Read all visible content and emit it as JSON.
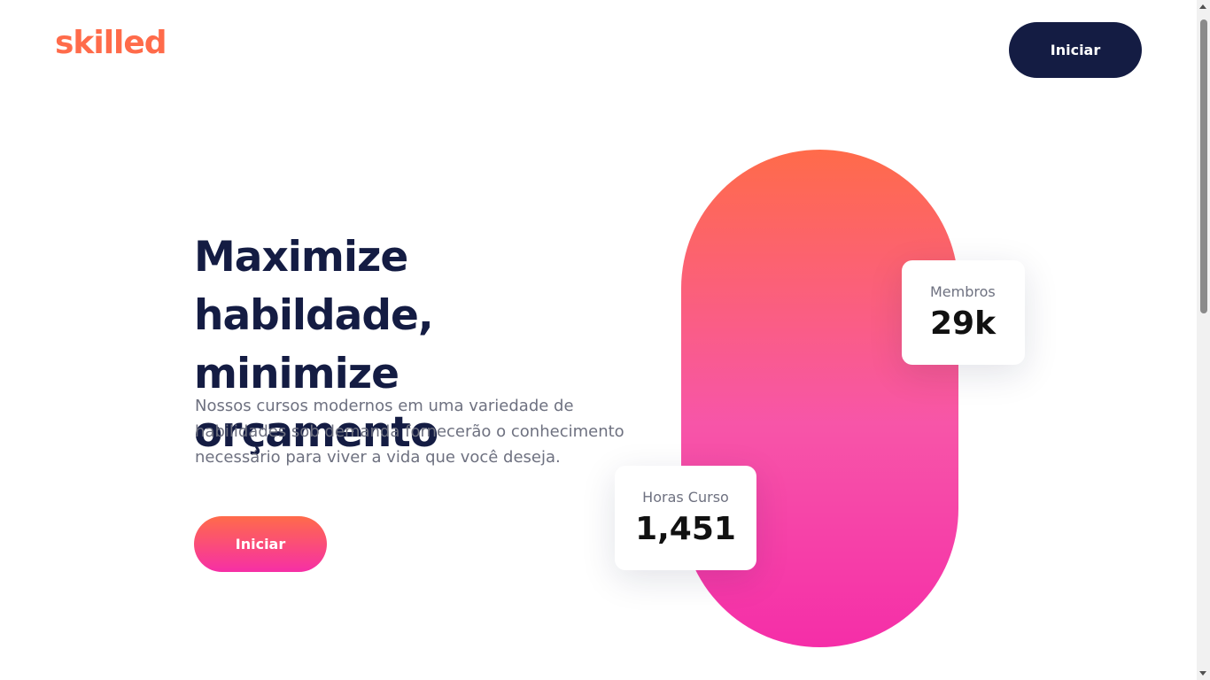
{
  "header": {
    "logo": "skilled",
    "cta_label": "Iniciar"
  },
  "hero": {
    "headline_line1": "Maximize habildade,",
    "headline_line2": "minimize orçamento",
    "subtext": "Nossos cursos modernos em uma variedade de habilidades sob demanda fornecerão o conhecimento necessário para viver a vida que você deseja.",
    "cta_label": "Iniciar"
  },
  "stats": {
    "members": {
      "label": "Membros",
      "value": "29k"
    },
    "hours": {
      "label": "Horas Curso",
      "value": "1,451"
    }
  },
  "colors": {
    "brand_orange": "#ff6b4a",
    "brand_pink": "#f62fa6",
    "navy": "#141c43"
  }
}
